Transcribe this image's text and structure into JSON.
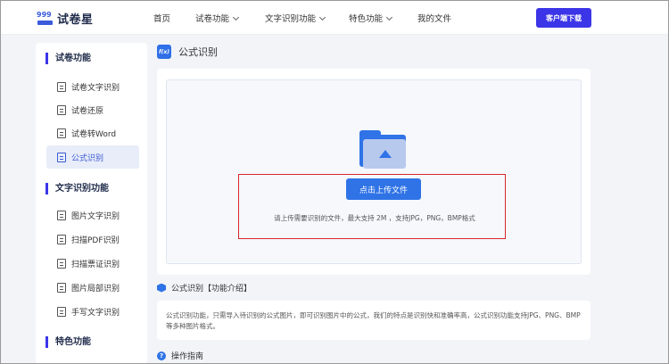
{
  "header": {
    "logo_mark": "999",
    "logo_text": "试卷星",
    "nav": [
      {
        "label": "首页",
        "has_dropdown": false
      },
      {
        "label": "试卷功能",
        "has_dropdown": true
      },
      {
        "label": "文字识别功能",
        "has_dropdown": true
      },
      {
        "label": "特色功能",
        "has_dropdown": true
      },
      {
        "label": "我的文件",
        "has_dropdown": false
      }
    ],
    "download_label": "客户端下载"
  },
  "sidebar": {
    "sections": [
      {
        "title": "试卷功能",
        "items": [
          {
            "label": "试卷文字识别",
            "active": false
          },
          {
            "label": "试卷还原",
            "active": false
          },
          {
            "label": "试卷转Word",
            "active": false
          },
          {
            "label": "公式识别",
            "active": true
          }
        ]
      },
      {
        "title": "文字识别功能",
        "items": [
          {
            "label": "图片文字识别",
            "active": false
          },
          {
            "label": "扫描PDF识别",
            "active": false
          },
          {
            "label": "扫描票证识别",
            "active": false
          },
          {
            "label": "图片局部识别",
            "active": false
          },
          {
            "label": "手写文字识别",
            "active": false
          }
        ]
      },
      {
        "title": "特色功能",
        "items": []
      }
    ]
  },
  "main": {
    "title_icon_glyph": "f(x)",
    "title": "公式识别",
    "upload": {
      "button_label": "点击上传文件",
      "hint": "请上传需要识别的文件，最大支持 2M ，支持JPG，PNG，BMP格式"
    },
    "intro": {
      "title": "公式识别【功能介绍】",
      "line1": "公式识别功能，只需导入待识别的公式图片，即可识别图片中的公式，我们的特点是识别快和准确率高，公式识别功能支持JPG、PNG、BMP",
      "line2": "等多种图片格式。"
    },
    "guide": {
      "icon_glyph": "?",
      "title": "操作指南"
    }
  },
  "colors": {
    "accent": "#3c35e8",
    "primary_blue": "#2f73e6",
    "active_bg": "#e8edf9",
    "highlight_box": "#d9262e"
  }
}
